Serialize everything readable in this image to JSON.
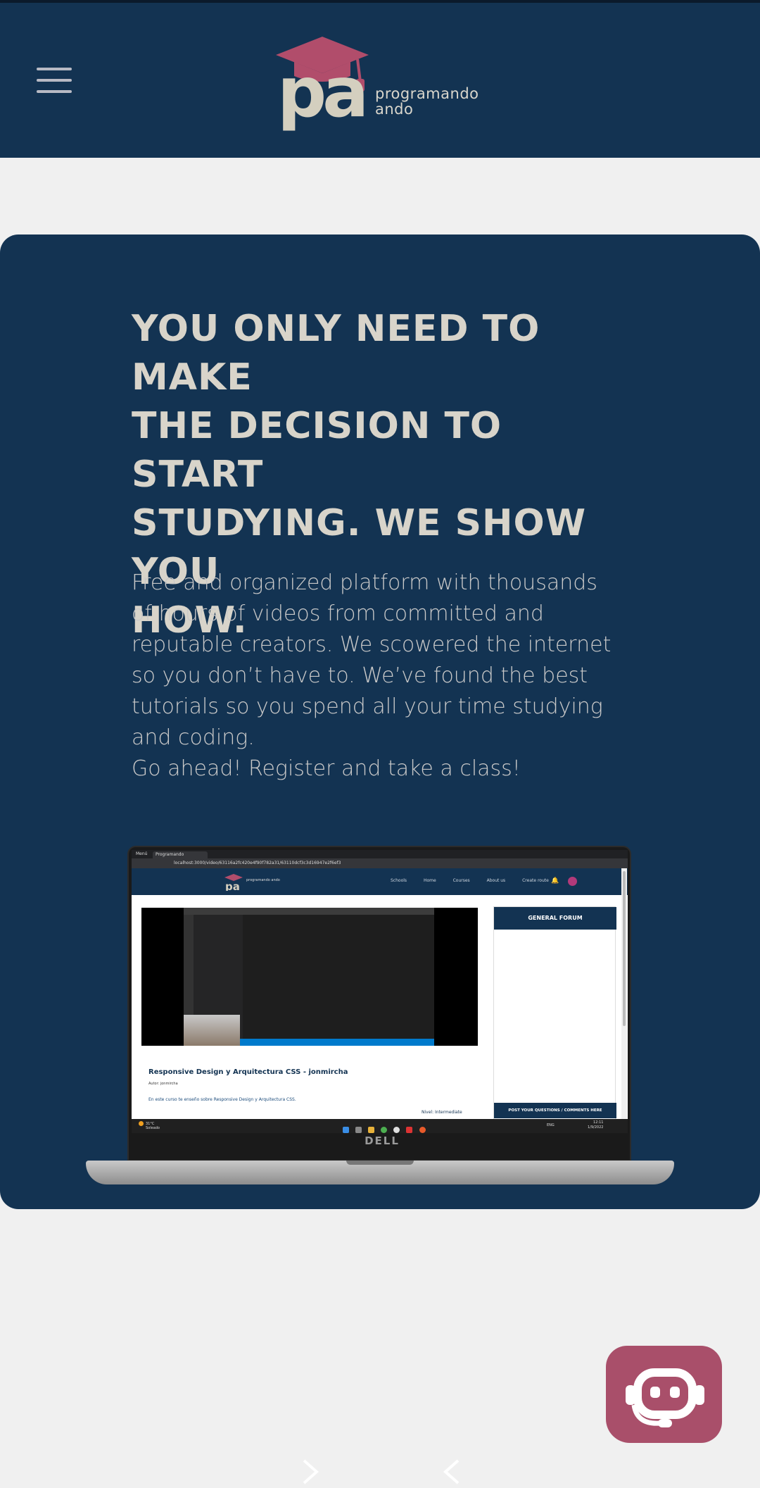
{
  "header": {
    "menu_icon": "hamburger-menu-icon",
    "logo_mark": "pa",
    "logo_text_line1": "programando",
    "logo_text_line2": "ando"
  },
  "hero": {
    "title_lines": [
      "YOU ONLY NEED TO MAKE",
      "THE DECISION TO START",
      "STUDYING. WE SHOW YOU",
      "HOW."
    ],
    "description_lines": [
      "Free and organized platform with thousands",
      "of hours of videos from committed and",
      "reputable creators. We scowered the internet",
      "so you don’t have to. We’ve found the best",
      "tutorials so you spend all your time studying",
      "and coding.",
      "Go ahead! Register and take a class!"
    ]
  },
  "laptop_screen": {
    "browser": {
      "menu_label": "Menú",
      "tab_title": "Programando",
      "url": "localhost:3000/video/63116a2fc420e4f90f782a31/63110dcf3c3d16947e2f6ef3"
    },
    "site_nav": {
      "logo_text": "programando ando",
      "links": [
        "Schools",
        "Home",
        "Courses",
        "About us",
        "Create route"
      ]
    },
    "course": {
      "title": "Responsive Design y Arquitectura CSS - jonmircha",
      "author": "Autor: jonmircha",
      "description": "En este curso te enseño sobre Responsive Design y Arquitectura CSS.",
      "level": "Nivel: Intermediate"
    },
    "forum": {
      "title": "GENERAL FORUM",
      "footer": "POST YOUR QUESTIONS / COMMENTS HERE"
    },
    "taskbar": {
      "weather_temp": "31°C",
      "weather_desc": "Soleado",
      "lang": "ENG",
      "time": "12:11",
      "date": "1/9/2022"
    },
    "brand": "DELL"
  },
  "colors": {
    "navy": "#133352",
    "cap_pink": "#b14d6b",
    "logo_cream": "#d4cfbf",
    "page_bg": "#f0f0f0"
  },
  "chatbot": {
    "icon": "robot-headset-icon"
  },
  "carousel": {
    "next_icon": "chevron-right-icon",
    "prev_icon": "chevron-left-icon"
  }
}
